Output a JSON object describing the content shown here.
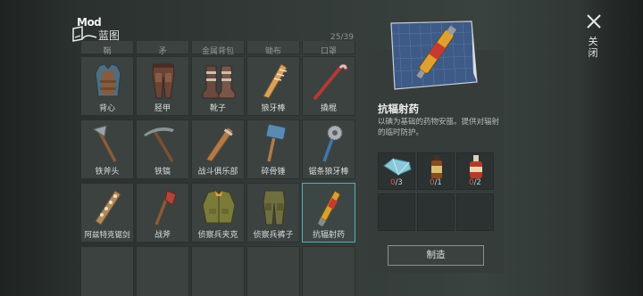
{
  "header": {
    "logo_text": "Mod",
    "title": "蓝图",
    "count": "25/39"
  },
  "grid": {
    "top_row_cut": [
      "鞘",
      "矛",
      "金属背包",
      "锄布",
      "口罩"
    ],
    "rows": [
      [
        {
          "label": "背心",
          "icon": "vest-icon"
        },
        {
          "label": "胫甲",
          "icon": "leg-armor-icon"
        },
        {
          "label": "靴子",
          "icon": "boots-icon"
        },
        {
          "label": "狼牙棒",
          "icon": "spiked-club-icon"
        },
        {
          "label": "撬棍",
          "icon": "crowbar-icon"
        }
      ],
      [
        {
          "label": "铁斧头",
          "icon": "axe-icon"
        },
        {
          "label": "铁镐",
          "icon": "pickaxe-icon"
        },
        {
          "label": "战斗俱乐部",
          "icon": "combat-club-icon"
        },
        {
          "label": "碎骨锤",
          "icon": "sledgehammer-icon"
        },
        {
          "label": "锯条狼牙棒",
          "icon": "saw-mace-icon"
        }
      ],
      [
        {
          "label": "阿兹特克锯剑",
          "icon": "aztec-sword-icon"
        },
        {
          "label": "战斧",
          "icon": "battle-axe-icon"
        },
        {
          "label": "侦察兵夹克",
          "icon": "scout-jacket-icon"
        },
        {
          "label": "侦察兵裤子",
          "icon": "scout-pants-icon"
        },
        {
          "label": "抗辐射药",
          "icon": "antirad-syringe-icon"
        }
      ]
    ]
  },
  "detail": {
    "name": "抗辐射药",
    "description": "以碘为基础的药物安瓿。提供对辐射的临时防护。",
    "materials": [
      {
        "icon": "crystal-icon",
        "have": "0",
        "need": "/3"
      },
      {
        "icon": "small-bottle-icon",
        "have": "0",
        "need": "/1"
      },
      {
        "icon": "red-bottle-icon",
        "have": "0",
        "need": "/2"
      }
    ],
    "craft_label": "制造"
  },
  "close_label": "关闭",
  "colors": {
    "selected_border": "#4fb3b0",
    "missing_count": "#e0544d",
    "background": "#2a302e"
  }
}
